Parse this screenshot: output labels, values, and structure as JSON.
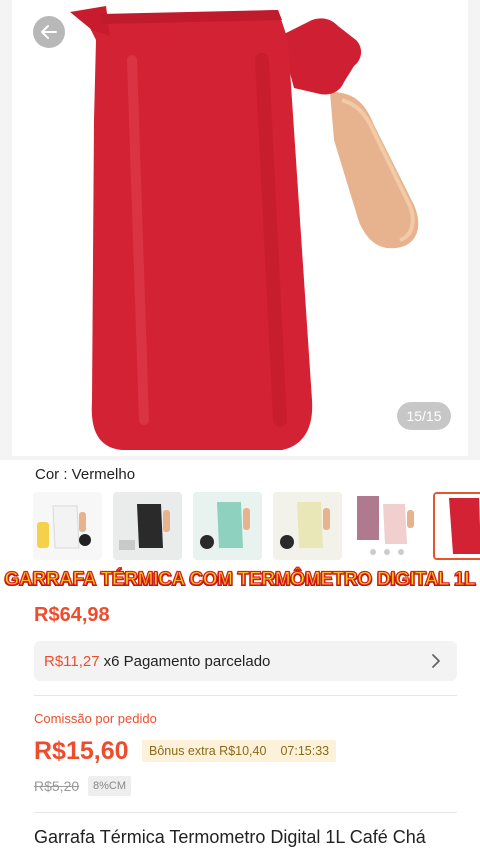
{
  "hero": {
    "image_counter": "15/15",
    "product_color_hex": "#d32233",
    "handle_color_hex": "#e7b38e"
  },
  "variant": {
    "color_label": "Cor : Vermelho",
    "thumbnails": [
      {
        "name": "white",
        "color": "#f1f1f1",
        "selected": false
      },
      {
        "name": "black",
        "color": "#2a2a2a",
        "selected": false
      },
      {
        "name": "green",
        "color": "#8fd1bf",
        "selected": false
      },
      {
        "name": "beige",
        "color": "#e9e7b8",
        "selected": false
      },
      {
        "name": "pink-box",
        "color": "#f1cfcf",
        "selected": false
      },
      {
        "name": "red",
        "color": "#d32233",
        "selected": true
      }
    ]
  },
  "banner": "GARRAFA TÉRMICA COM TERMÔMETRO DIGITAL 1L",
  "price": "R$64,98",
  "installment": {
    "amount": "R$11,27",
    "text": "x6 Pagamento parcelado"
  },
  "commission": {
    "label": "Comissão por pedido",
    "value": "R$15,60",
    "bonus": "Bônus extra R$10,40",
    "timer": "07:15:33",
    "old_value": "R$5,20",
    "cm_rate": "8%CM"
  },
  "product_title": "Garrafa Térmica Termometro Digital 1L Café Chá",
  "colors": {
    "accent": "#ee4d2d",
    "banner_text": "#ffcf1a",
    "banner_stroke": "#d62020"
  }
}
